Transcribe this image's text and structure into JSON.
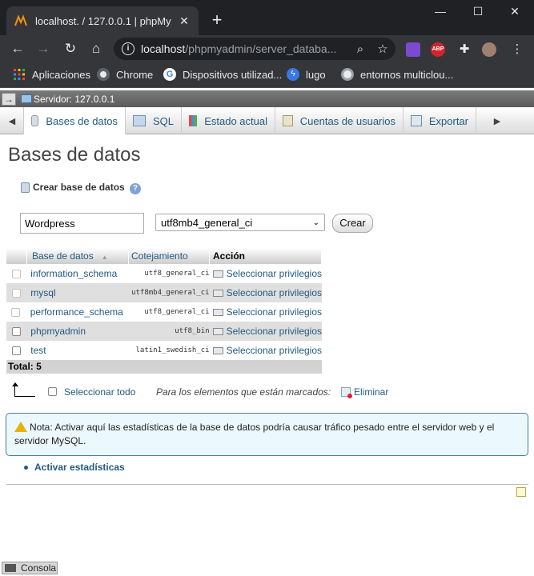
{
  "browser": {
    "tab_title": "localhost. / 127.0.0.1 | phpMyAdmin",
    "url_host": "localhost",
    "url_path": "/phpmyadmin/server_databa...",
    "new_tab_symbol": "+",
    "bookmarks": [
      {
        "label": "Aplicaciones",
        "icon": "apps-grid-icon"
      },
      {
        "label": "Chrome",
        "icon": "chrome-icon"
      },
      {
        "label": "Dispositivos utilizad...",
        "icon": "google-icon"
      },
      {
        "label": "lugo",
        "icon": "bolt-icon"
      },
      {
        "label": "entornos multiclou...",
        "icon": "globe-icon"
      }
    ],
    "extension_abp_label": "ABP"
  },
  "pma": {
    "server_label": "Servidor: 127.0.0.1",
    "menu": [
      {
        "label": "Bases de datos",
        "active": true
      },
      {
        "label": "SQL",
        "active": false
      },
      {
        "label": "Estado actual",
        "active": false
      },
      {
        "label": "Cuentas de usuarios",
        "active": false
      },
      {
        "label": "Exportar",
        "active": false
      }
    ],
    "page_title": "Bases de datos",
    "create": {
      "label": "Crear base de datos",
      "help_symbol": "?",
      "name_value": "Wordpress",
      "collation_value": "utf8mb4_general_ci",
      "button_label": "Crear"
    },
    "table": {
      "headers": {
        "name": "Base de datos",
        "collation": "Cotejamiento",
        "action": "Acción"
      },
      "rows": [
        {
          "name": "information_schema",
          "collation": "utf8_general_ci",
          "action": "Seleccionar privilegios",
          "disabled": true
        },
        {
          "name": "mysql",
          "collation": "utf8mb4_general_ci",
          "action": "Seleccionar privilegios",
          "disabled": true
        },
        {
          "name": "performance_schema",
          "collation": "utf8_general_ci",
          "action": "Seleccionar privilegios",
          "disabled": true
        },
        {
          "name": "phpmyadmin",
          "collation": "utf8_bin",
          "action": "Seleccionar privilegios",
          "disabled": false
        },
        {
          "name": "test",
          "collation": "latin1_swedish_ci",
          "action": "Seleccionar privilegios",
          "disabled": false
        }
      ],
      "total_label": "Total: 5"
    },
    "bulk": {
      "select_all_label": "Seleccionar todo",
      "with_selected_label": "Para los elementos que están marcados:",
      "drop_label": "Eliminar"
    },
    "notice": "Nota: Activar aquí las estadísticas de la base de datos podría causar tráfico pesado entre el servidor web y el servidor MySQL.",
    "activate_stats_label": "Activar estadísticas",
    "console_label": "Consola"
  }
}
